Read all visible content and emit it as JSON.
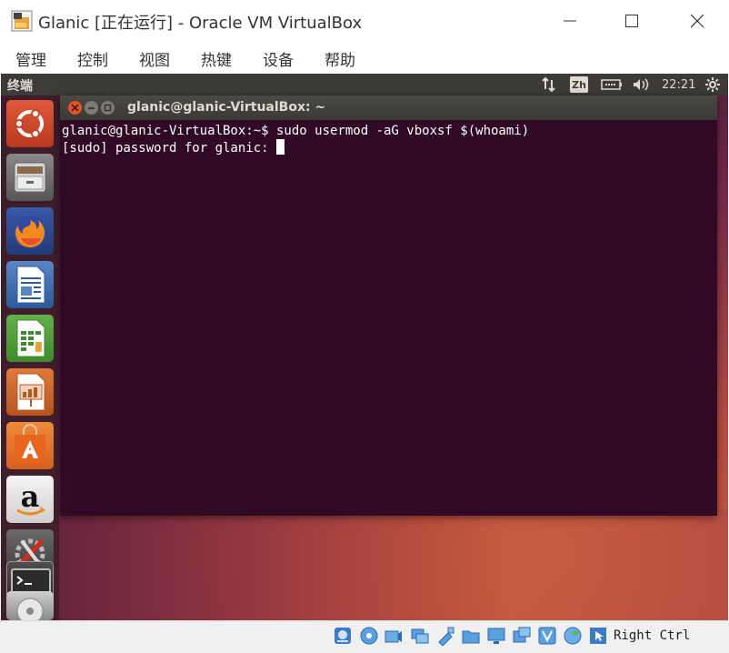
{
  "window": {
    "title": "Glanic [正在运行] - Oracle VM VirtualBox"
  },
  "menu": {
    "items": [
      "管理",
      "控制",
      "视图",
      "热键",
      "设备",
      "帮助"
    ]
  },
  "guest": {
    "panel": {
      "app_title": "终端",
      "input_method": "Zh",
      "clock": "22:21"
    },
    "launcher": {
      "items": [
        "ubuntu-dash",
        "files",
        "firefox",
        "libreoffice-writer",
        "libreoffice-calc",
        "libreoffice-impress",
        "ubuntu-software",
        "amazon",
        "system-settings",
        "terminal",
        "dvd"
      ]
    },
    "terminal": {
      "title": "glanic@glanic-VirtualBox: ~",
      "line1": "glanic@glanic-VirtualBox:~$ sudo usermod -aG vboxsf $(whoami)",
      "line2": "[sudo] password for glanic: "
    }
  },
  "statusbar": {
    "host_key": "Right Ctrl"
  },
  "colors": {
    "terminal_bg": "#300a24",
    "panel_bg": "#3c3b37",
    "launcher_bg": "#3c1e28"
  }
}
